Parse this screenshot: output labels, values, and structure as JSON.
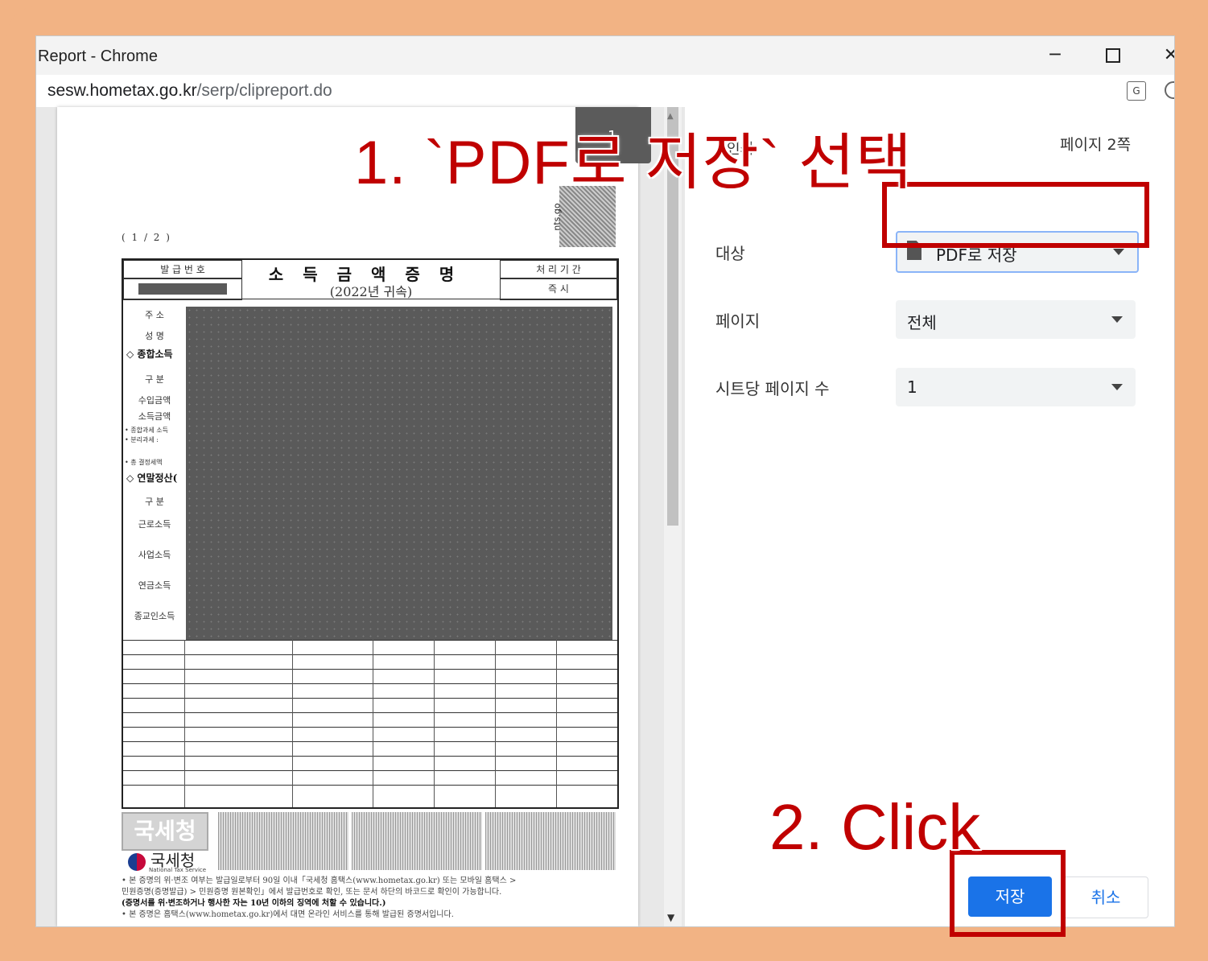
{
  "window": {
    "title": "Report - Chrome",
    "controls": {
      "minimize": "─",
      "close": "✕"
    }
  },
  "address": {
    "host": "sesw.hometax.go.kr",
    "path": "/serp/clipreport.do"
  },
  "preview": {
    "page_badge": "1",
    "doc_number": "( 1 / 2 )",
    "form": {
      "issue_number_label": "발 급 번 호",
      "title": "소득금액증명",
      "subtitle": "(2022년 귀속)",
      "processing_period_label": "처 리 기 간",
      "processing_value": "즉    시",
      "rows": [
        {
          "label": "주    소"
        },
        {
          "label": "성    명"
        },
        {
          "label": "구 분"
        },
        {
          "label": "수입금액"
        },
        {
          "label": "소득금액"
        },
        {
          "label": "구 분"
        },
        {
          "label": "근로소득"
        },
        {
          "label": "사업소득"
        },
        {
          "label": "연금소득"
        },
        {
          "label": "종교인소득"
        }
      ],
      "sections": [
        "◇ 종합소득",
        "◇ 연말정산("
      ],
      "small_notes": [
        "• 종합과세 소득",
        "• 분리과세 :",
        "• 총 결정세액"
      ]
    },
    "footer": {
      "stamp_text": "국세청",
      "logo_text": "국세청",
      "logo_sub": "National Tax Service",
      "notes": [
        "• 본 증명의 위·변조 여부는 발급일로부터 90일 이내「국세청 홈택스(www.hometax.go.kr) 또는 모바일 홈택스 >",
        "민원증명(증명발급) > 민원증명 원본확인」에서 발급번호로 확인, 또는 문서 하단의 바코드로 확인이 가능합니다.",
        "(증명서를 위·변조하거나 행사한 자는 10년 이하의 징역에 처할 수 있습니다.)",
        "• 본 증명은 홈택스(www.hometax.go.kr)에서 대면 온라인 서비스를 통해 발급된 증명서입니다."
      ],
      "nts_mark": "nts.go"
    }
  },
  "settings": {
    "pages_count": "페이지 2쪽",
    "partial_label": "인쇄",
    "destination": {
      "label": "대상",
      "value": "PDF로 저장"
    },
    "pages": {
      "label": "페이지",
      "value": "전체"
    },
    "per_sheet": {
      "label": "시트당 페이지 수",
      "value": "1"
    },
    "save_button": "저장",
    "cancel_button": "취소"
  },
  "annotations": {
    "step1": "1. `PDF로 저장` 선택",
    "step2": "2. Click",
    "color": "#c00000"
  }
}
